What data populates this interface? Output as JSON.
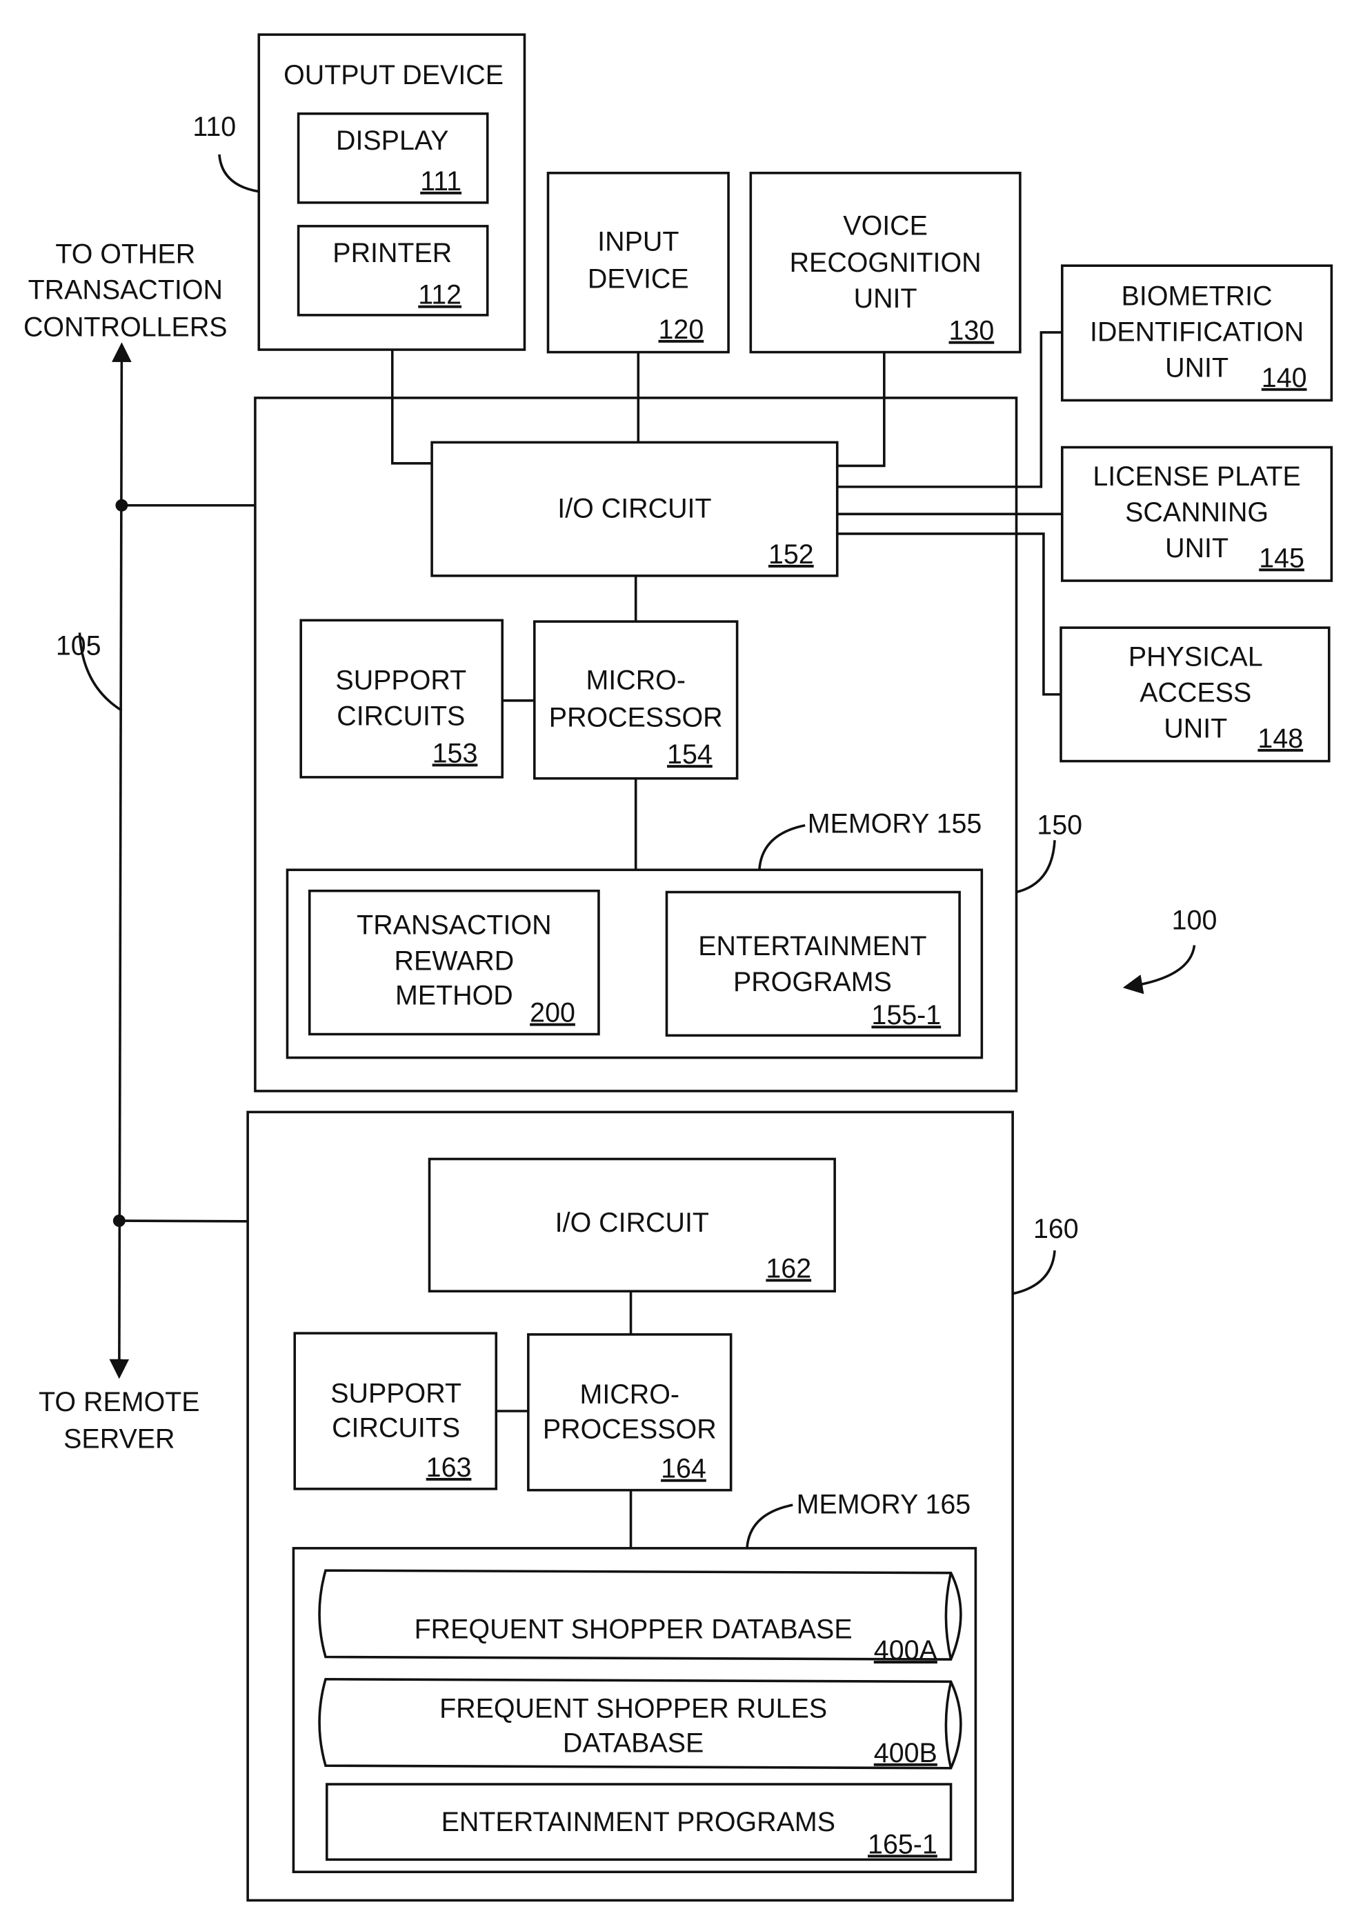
{
  "figure": {
    "system_ref": "100",
    "bus_ref": "105",
    "bus_top_label": [
      "TO OTHER",
      "TRANSACTION",
      "CONTROLLERS"
    ],
    "bus_bottom_label": [
      "TO REMOTE",
      "SERVER"
    ]
  },
  "output_device": {
    "ref": "110",
    "title": "OUTPUT DEVICE",
    "display": {
      "label": "DISPLAY",
      "ref": "111"
    },
    "printer": {
      "label": "PRINTER",
      "ref": "112"
    }
  },
  "input_device": {
    "lines": [
      "INPUT",
      "DEVICE"
    ],
    "ref": "120"
  },
  "voice_unit": {
    "lines": [
      "VOICE",
      "RECOGNITION",
      "UNIT"
    ],
    "ref": "130"
  },
  "biometric_unit": {
    "lines": [
      "BIOMETRIC",
      "IDENTIFICATION",
      "UNIT"
    ],
    "ref": "140"
  },
  "license_unit": {
    "lines": [
      "LICENSE PLATE",
      "SCANNING",
      "UNIT"
    ],
    "ref": "145"
  },
  "access_unit": {
    "lines": [
      "PHYSICAL",
      "ACCESS",
      "UNIT"
    ],
    "ref": "148"
  },
  "controller_150": {
    "ref": "150",
    "io": {
      "label": "I/O CIRCUIT",
      "ref": "152"
    },
    "support": {
      "lines": [
        "SUPPORT",
        "CIRCUITS"
      ],
      "ref": "153"
    },
    "cpu": {
      "lines": [
        "MICRO-",
        "PROCESSOR"
      ],
      "ref": "154"
    },
    "memory_label": "MEMORY 155",
    "reward": {
      "lines": [
        "TRANSACTION",
        "REWARD",
        "METHOD"
      ],
      "ref": "200"
    },
    "entertainment": {
      "lines": [
        "ENTERTAINMENT",
        "PROGRAMS"
      ],
      "ref": "155-1"
    }
  },
  "controller_160": {
    "ref": "160",
    "io": {
      "label": "I/O CIRCUIT",
      "ref": "162"
    },
    "support": {
      "lines": [
        "SUPPORT",
        "CIRCUITS"
      ],
      "ref": "163"
    },
    "cpu": {
      "lines": [
        "MICRO-",
        "PROCESSOR"
      ],
      "ref": "164"
    },
    "memory_label": "MEMORY 165",
    "db_a": {
      "lines": [
        "FREQUENT SHOPPER DATABASE"
      ],
      "ref": "400A"
    },
    "db_b": {
      "lines": [
        "FREQUENT SHOPPER RULES",
        "DATABASE"
      ],
      "ref": "400B"
    },
    "entertainment": {
      "lines": [
        "ENTERTAINMENT PROGRAMS"
      ],
      "ref": "165-1"
    }
  }
}
